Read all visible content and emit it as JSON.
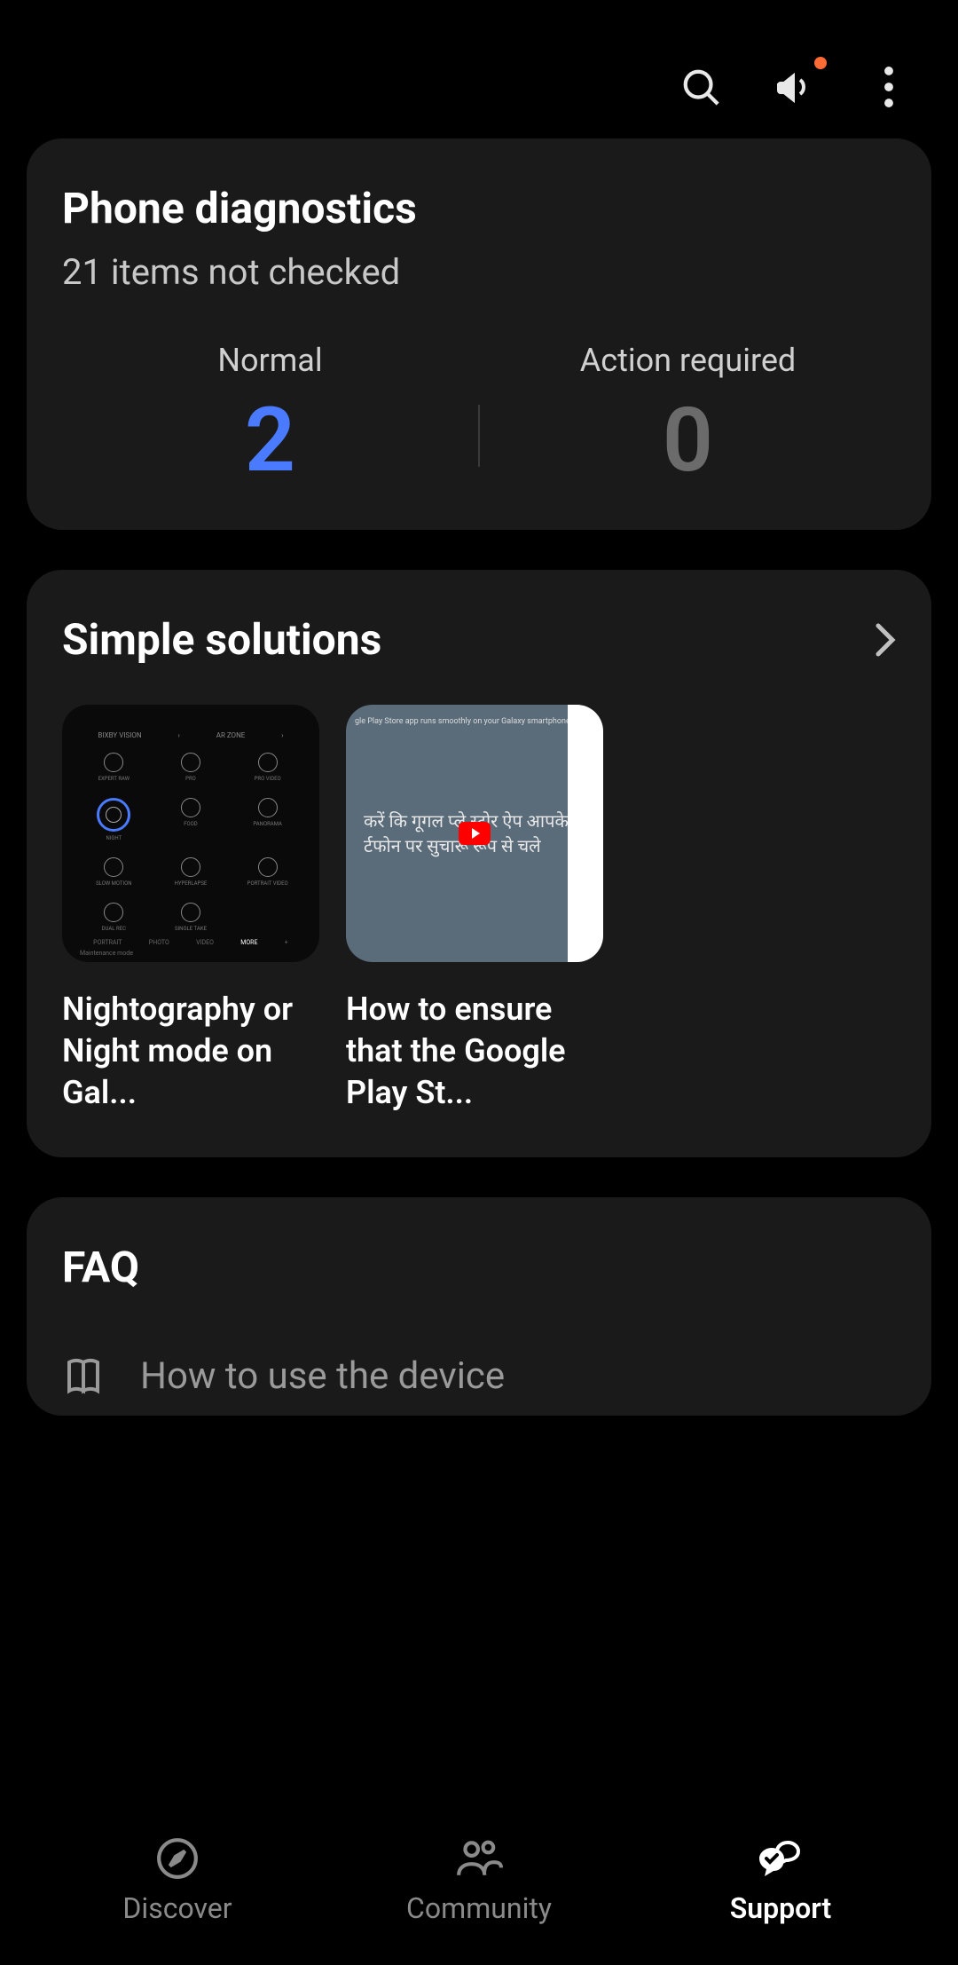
{
  "diagnostics": {
    "title": "Phone diagnostics",
    "subtitle": "21 items not checked",
    "normal_label": "Normal",
    "normal_value": "2",
    "action_label": "Action required",
    "action_value": "0"
  },
  "solutions": {
    "title": "Simple solutions",
    "items": [
      {
        "title": "Nightography or Night mode on Gal...",
        "thumb_text1": "सुनिश्चित करें कि गूगल प्ले स्टोर ऐप आपके",
        "thumb_text2": "स्मार्टफोन पर सुचारू रूप से चले"
      },
      {
        "title": "How to ensure that the Google Play St...",
        "banner": "gle Play Store app runs smoothly on your Galaxy smartphone",
        "thumb_text1": "करें कि गूगल प्ले स्टोर ऐप आपके",
        "thumb_text2": "र्टफोन पर सुचारू रूप से चले"
      }
    ]
  },
  "faq": {
    "title": "FAQ",
    "item1": "How to use the device"
  },
  "nav": {
    "discover": "Discover",
    "community": "Community",
    "support": "Support"
  }
}
